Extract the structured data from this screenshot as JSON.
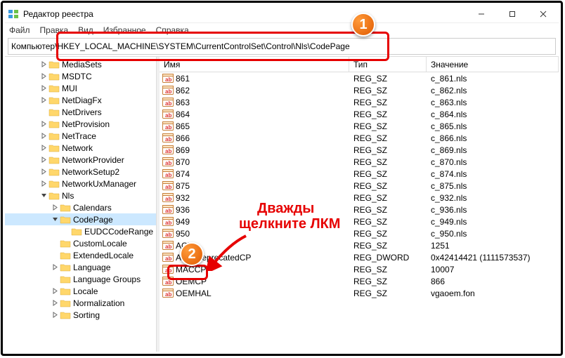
{
  "window": {
    "title": "Редактор реестра",
    "minimize": "—",
    "maximize": "☐",
    "close": "✕"
  },
  "menu": {
    "file": "Файл",
    "edit": "Правка",
    "view": "Вид",
    "favorites": "Избранное",
    "help": "Справка"
  },
  "address": {
    "prefix": "Компьютер\\",
    "path": "HKEY_LOCAL_MACHINE\\SYSTEM\\CurrentControlSet\\Control\\Nls\\CodePage"
  },
  "columns": {
    "name": "Имя",
    "type": "Тип",
    "value": "Значение"
  },
  "tree": [
    {
      "label": "MediaSets",
      "indent": 48,
      "expander": ">"
    },
    {
      "label": "MSDTC",
      "indent": 48,
      "expander": ">"
    },
    {
      "label": "MUI",
      "indent": 48,
      "expander": ">"
    },
    {
      "label": "NetDiagFx",
      "indent": 48,
      "expander": ">"
    },
    {
      "label": "NetDrivers",
      "indent": 48,
      "expander": ""
    },
    {
      "label": "NetProvision",
      "indent": 48,
      "expander": ">"
    },
    {
      "label": "NetTrace",
      "indent": 48,
      "expander": ">"
    },
    {
      "label": "Network",
      "indent": 48,
      "expander": ">"
    },
    {
      "label": "NetworkProvider",
      "indent": 48,
      "expander": ">"
    },
    {
      "label": "NetworkSetup2",
      "indent": 48,
      "expander": ">"
    },
    {
      "label": "NetworkUxManager",
      "indent": 48,
      "expander": ">"
    },
    {
      "label": "Nls",
      "indent": 48,
      "expander": "v"
    },
    {
      "label": "Calendars",
      "indent": 64,
      "expander": ">"
    },
    {
      "label": "CodePage",
      "indent": 64,
      "expander": "v",
      "selected": true
    },
    {
      "label": "EUDCCodeRange",
      "indent": 80,
      "expander": ""
    },
    {
      "label": "CustomLocale",
      "indent": 64,
      "expander": ""
    },
    {
      "label": "ExtendedLocale",
      "indent": 64,
      "expander": ""
    },
    {
      "label": "Language",
      "indent": 64,
      "expander": ">"
    },
    {
      "label": "Language Groups",
      "indent": 64,
      "expander": ""
    },
    {
      "label": "Locale",
      "indent": 64,
      "expander": ">"
    },
    {
      "label": "Normalization",
      "indent": 64,
      "expander": ">"
    },
    {
      "label": "Sorting",
      "indent": 64,
      "expander": ">"
    }
  ],
  "rows": [
    {
      "name": "861",
      "type": "REG_SZ",
      "value": "c_861.nls"
    },
    {
      "name": "862",
      "type": "REG_SZ",
      "value": "c_862.nls"
    },
    {
      "name": "863",
      "type": "REG_SZ",
      "value": "c_863.nls"
    },
    {
      "name": "864",
      "type": "REG_SZ",
      "value": "c_864.nls"
    },
    {
      "name": "865",
      "type": "REG_SZ",
      "value": "c_865.nls"
    },
    {
      "name": "866",
      "type": "REG_SZ",
      "value": "c_866.nls"
    },
    {
      "name": "869",
      "type": "REG_SZ",
      "value": "c_869.nls"
    },
    {
      "name": "870",
      "type": "REG_SZ",
      "value": "c_870.nls"
    },
    {
      "name": "874",
      "type": "REG_SZ",
      "value": "c_874.nls"
    },
    {
      "name": "875",
      "type": "REG_SZ",
      "value": "c_875.nls"
    },
    {
      "name": "932",
      "type": "REG_SZ",
      "value": "c_932.nls"
    },
    {
      "name": "936",
      "type": "REG_SZ",
      "value": "c_936.nls"
    },
    {
      "name": "949",
      "type": "REG_SZ",
      "value": "c_949.nls"
    },
    {
      "name": "950",
      "type": "REG_SZ",
      "value": "c_950.nls"
    },
    {
      "name": "ACP",
      "type": "REG_SZ",
      "value": "1251"
    },
    {
      "name": "AllowDeprecatedCP",
      "type": "REG_DWORD",
      "value": "0x42414421 (1111573537)"
    },
    {
      "name": "MACCP",
      "type": "REG_SZ",
      "value": "10007"
    },
    {
      "name": "OEMCP",
      "type": "REG_SZ",
      "value": "866"
    },
    {
      "name": "OEMHAL",
      "type": "REG_SZ",
      "value": "vgaoem.fon"
    }
  ],
  "annotation": {
    "badge1": "1",
    "badge2": "2",
    "text_line1": "Дважды",
    "text_line2": "щелкните ЛКМ"
  }
}
